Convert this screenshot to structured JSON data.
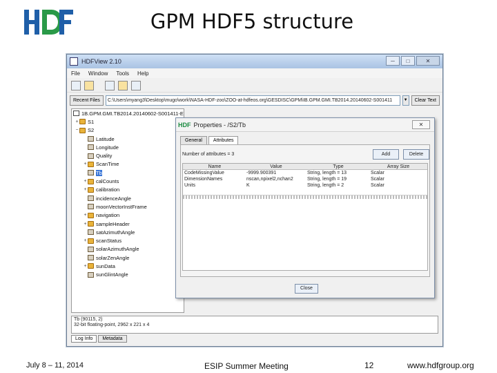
{
  "slide": {
    "title": "GPM HDF5 structure",
    "logo_text": "HDF",
    "footer_date": "July 8 – 11, 2014",
    "footer_meeting": "ESIP Summer Meeting",
    "footer_page": "12",
    "footer_url": "www.hdfgroup.org"
  },
  "window": {
    "title": "HDFView 2.10",
    "menu": [
      "File",
      "Window",
      "Tools",
      "Help"
    ],
    "recent_files_label": "Recent Files",
    "recent_path": "C:\\Users\\myang3\\Desktop\\mugo\\work\\NASA-HDF-zoo\\ZOO-at-hdfeos.org\\GESDISC\\GPM\\IB.GPM.GMI.TB2014.20140602-S001411",
    "clear_text_label": "Clear Text"
  },
  "tree": {
    "file_name": "1B.GPM.GMI.TB2014.20140602-S001411-E0",
    "items": [
      {
        "label": "S1",
        "kind": "group",
        "level": 1,
        "toggle": "+"
      },
      {
        "label": "S2",
        "kind": "group",
        "level": 1,
        "toggle": "−"
      },
      {
        "label": "Latitude",
        "kind": "dataset",
        "level": 2,
        "toggle": ""
      },
      {
        "label": "Longitude",
        "kind": "dataset",
        "level": 2,
        "toggle": ""
      },
      {
        "label": "Quality",
        "kind": "dataset",
        "level": 2,
        "toggle": ""
      },
      {
        "label": "ScanTime",
        "kind": "group",
        "level": 2,
        "toggle": "+"
      },
      {
        "label": "Tb",
        "kind": "dataset",
        "level": 2,
        "toggle": "",
        "selected": true
      },
      {
        "label": "calCounts",
        "kind": "group",
        "level": 2,
        "toggle": "+"
      },
      {
        "label": "calibration",
        "kind": "group",
        "level": 2,
        "toggle": "+"
      },
      {
        "label": "incidenceAngle",
        "kind": "dataset",
        "level": 2,
        "toggle": ""
      },
      {
        "label": "moonVectorInstFrame",
        "kind": "dataset",
        "level": 2,
        "toggle": ""
      },
      {
        "label": "navigation",
        "kind": "group",
        "level": 2,
        "toggle": "+"
      },
      {
        "label": "sampleHeader",
        "kind": "group",
        "level": 2,
        "toggle": "+"
      },
      {
        "label": "satAzimuthAngle",
        "kind": "dataset",
        "level": 2,
        "toggle": ""
      },
      {
        "label": "scanStatus",
        "kind": "group",
        "level": 2,
        "toggle": "+"
      },
      {
        "label": "solarAzimuthAngle",
        "kind": "dataset",
        "level": 2,
        "toggle": ""
      },
      {
        "label": "solarZenAngle",
        "kind": "dataset",
        "level": 2,
        "toggle": ""
      },
      {
        "label": "sunData",
        "kind": "group",
        "level": 2,
        "toggle": "+"
      },
      {
        "label": "sunGlintAngle",
        "kind": "dataset",
        "level": 2,
        "toggle": ""
      }
    ]
  },
  "info": {
    "line1": "Tb (90115, 2)",
    "line2": "32-bit floating-point, 2962 x 221 x 4"
  },
  "bottom_tabs": [
    "Log Info",
    "Metadata"
  ],
  "dialog": {
    "title": "Properties - /S2/Tb",
    "logo": "HDF",
    "tabs": [
      "General",
      "Attributes"
    ],
    "attr_count": "Number of attributes = 3",
    "add_label": "Add",
    "delete_label": "Delete",
    "close_label": "Close",
    "columns": [
      "Name",
      "Value",
      "Type",
      "Array Size"
    ],
    "rows": [
      [
        "CodeMissingValue",
        "-9999.900391",
        "String, length = 13",
        "Scalar"
      ],
      [
        "DimensionNames",
        "nscan,npixel2,nchan2",
        "String, length = 19",
        "Scalar"
      ],
      [
        "Units",
        "K",
        "String, length = 2",
        "Scalar"
      ]
    ]
  },
  "colors": {
    "logo_blue": "#1f5fa8",
    "logo_green": "#2a9a48",
    "selection": "#3875d7"
  }
}
